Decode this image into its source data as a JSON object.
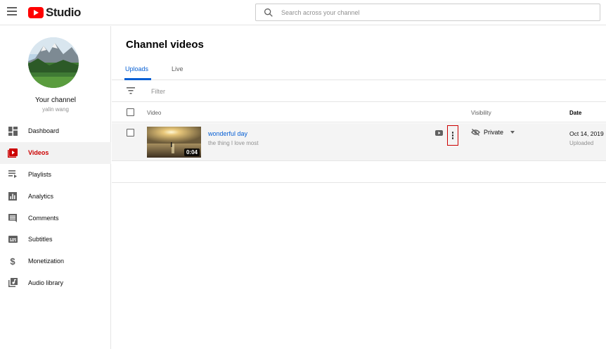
{
  "header": {
    "logo_text": "Studio",
    "search_placeholder": "Search across your channel"
  },
  "sidebar": {
    "channel_title": "Your channel",
    "channel_user": "yalin wang",
    "items": [
      {
        "label": "Dashboard",
        "icon": "dashboard-icon",
        "active": false
      },
      {
        "label": "Videos",
        "icon": "videos-icon",
        "active": true
      },
      {
        "label": "Playlists",
        "icon": "playlists-icon",
        "active": false
      },
      {
        "label": "Analytics",
        "icon": "analytics-icon",
        "active": false
      },
      {
        "label": "Comments",
        "icon": "comments-icon",
        "active": false
      },
      {
        "label": "Subtitles",
        "icon": "subtitles-icon",
        "active": false
      },
      {
        "label": "Monetization",
        "icon": "monetization-icon",
        "active": false
      },
      {
        "label": "Audio library",
        "icon": "audio-library-icon",
        "active": false
      }
    ]
  },
  "main": {
    "title": "Channel videos",
    "tabs": [
      {
        "label": "Uploads",
        "active": true
      },
      {
        "label": "Live",
        "active": false
      }
    ],
    "filter_label": "Filter",
    "columns": {
      "video": "Video",
      "visibility": "Visibility",
      "date": "Date"
    },
    "rows": [
      {
        "title": "wonderful day",
        "description": "the thing I love most",
        "duration": "0:04",
        "visibility": "Private",
        "date": "Oct 14, 2019",
        "date_status": "Uploaded"
      }
    ]
  },
  "colors": {
    "accent": "#065fd4",
    "brand": "#ff0000",
    "active_nav": "#cc0000"
  }
}
